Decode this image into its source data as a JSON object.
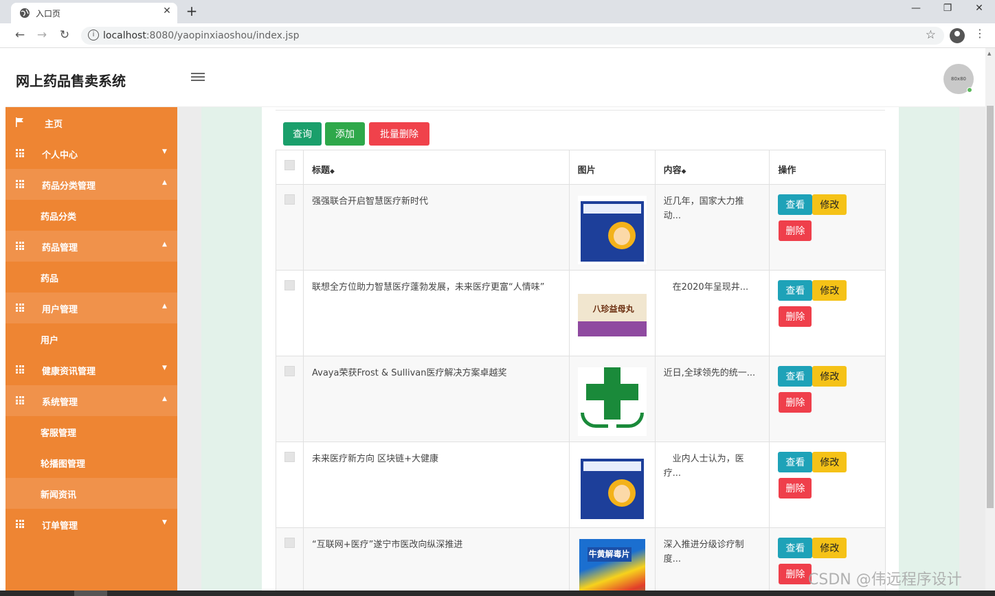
{
  "browser": {
    "tab_title": "入口页",
    "close_glyph": "✕",
    "new_tab_glyph": "+",
    "url_host": "localhost",
    "url_rest": ":8080/yaopinxiaoshou/index.jsp",
    "icons": [
      "globe-icon",
      "back-icon",
      "forward-icon",
      "reload-icon",
      "info-icon",
      "star-icon",
      "profile-icon",
      "kebab-icon"
    ]
  },
  "header": {
    "brand": "网上药品售卖系统",
    "avatar_text": "80x80"
  },
  "sidebar": {
    "items": [
      {
        "label": "主页",
        "icon": "flag-icon",
        "caret": ""
      },
      {
        "label": "个人中心",
        "icon": "grid-icon",
        "caret": "▼"
      },
      {
        "label": "药品分类管理",
        "icon": "grid-icon",
        "caret": "▲"
      },
      {
        "label": "药品分类",
        "icon": "",
        "caret": ""
      },
      {
        "label": "药品管理",
        "icon": "grid-icon",
        "caret": "▲"
      },
      {
        "label": "药品",
        "icon": "",
        "caret": ""
      },
      {
        "label": "用户管理",
        "icon": "grid-icon",
        "caret": "▲"
      },
      {
        "label": "用户",
        "icon": "",
        "caret": ""
      },
      {
        "label": "健康资讯管理",
        "icon": "grid-icon",
        "caret": "▼"
      },
      {
        "label": "系统管理",
        "icon": "grid-icon",
        "caret": "▲"
      },
      {
        "label": "客服管理",
        "icon": "",
        "caret": ""
      },
      {
        "label": "轮播图管理",
        "icon": "",
        "caret": ""
      },
      {
        "label": "新闻资讯",
        "icon": "",
        "caret": ""
      },
      {
        "label": "订单管理",
        "icon": "grid-icon",
        "caret": "▼"
      }
    ]
  },
  "toolbar": {
    "query": "查询",
    "add": "添加",
    "batch_delete": "批量删除"
  },
  "table": {
    "headers": {
      "title": "标题",
      "image": "图片",
      "content": "内容",
      "actions": "操作",
      "sort_glyph": "◆"
    },
    "rows": [
      {
        "title": "强强联合开启智慧医疗新时代",
        "image": "medicine-box-blue",
        "content": "近几年，国家大力推动..."
      },
      {
        "title": "联想全方位助力智慧医疗蓬勃发展，未来医疗更富“人情味”",
        "image": "medicine-box-cream",
        "content": "　在2020年呈现井..."
      },
      {
        "title": "Avaya荣获Frost & Sullivan医疗解决方案卓越奖",
        "image": "green-cross-logo",
        "content": "近日,全球领先的统一..."
      },
      {
        "title": "未来医疗新方向 区块链+大健康",
        "image": "medicine-box-blue",
        "content": "　业内人士认为，医疗..."
      },
      {
        "title": "“互联网+医疗”遂宁市医改向纵深推进",
        "image": "medicine-box-rainbow",
        "content": "深入推进分级诊疗制度..."
      }
    ],
    "row_actions": {
      "view": "查看",
      "edit": "修改",
      "delete": "删除"
    }
  },
  "image_text": {
    "cream_box": "八珍益母丸",
    "rainbow_box": "牛黄解毒片"
  },
  "watermark": "CSDN @伟远程序设计",
  "colors": {
    "sidebar": "#ee8533",
    "sidebar_alt": "#f0924b",
    "query_btn": "#1a9f6b",
    "add_btn": "#2ea84a",
    "delete_btn": "#f0424b",
    "view_btn": "#1ea2b8",
    "edit_btn": "#f5c217",
    "content_bg": "#e3f2ea"
  }
}
